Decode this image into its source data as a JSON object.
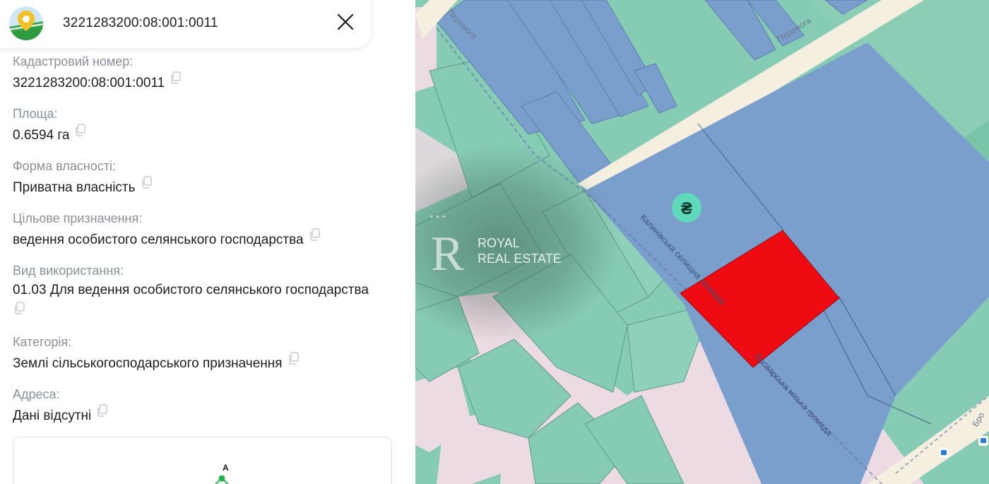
{
  "search": {
    "query": "3221283200:08:001:0011"
  },
  "fields": [
    {
      "label": "Кадастровий номер:",
      "value": "3221283200:08:001:0011"
    },
    {
      "label": "Площа:",
      "value": "0.6594 га"
    },
    {
      "label": "Форма власності:",
      "value": "Приватна власність"
    },
    {
      "label": "Цільове призначення:",
      "value": "ведення особистого селянського господарства"
    },
    {
      "label": "Вид використання:",
      "value": "01.03 Для ведення особистого селянського господарства"
    },
    {
      "label": "Категорія:",
      "value": "Землі сільськогосподарського призначення"
    },
    {
      "label": "Адреса:",
      "value": "Дані відсутні"
    }
  ],
  "minimap": {
    "vertex_label": "A"
  },
  "map": {
    "street_labels": [
      "Перемога",
      "Перемога",
      "Калинівська селищна громада",
      "Броварська міська громада",
      "Бро"
    ],
    "price_marker": "₴",
    "watermark": {
      "logo_letter": "R",
      "line1": "ROYAL",
      "line2": "REAL ESTATE"
    },
    "colors": {
      "green_parcel": "#86cbb4",
      "blue_parcel": "#7b9fcd",
      "selected_parcel": "#ee0c12",
      "road": "#f4efdf",
      "pink_area": "#ecdbe3",
      "marker": "#5fd9b9"
    },
    "icons": [
      "bus-stop-icon",
      "bus-stop-icon"
    ]
  }
}
